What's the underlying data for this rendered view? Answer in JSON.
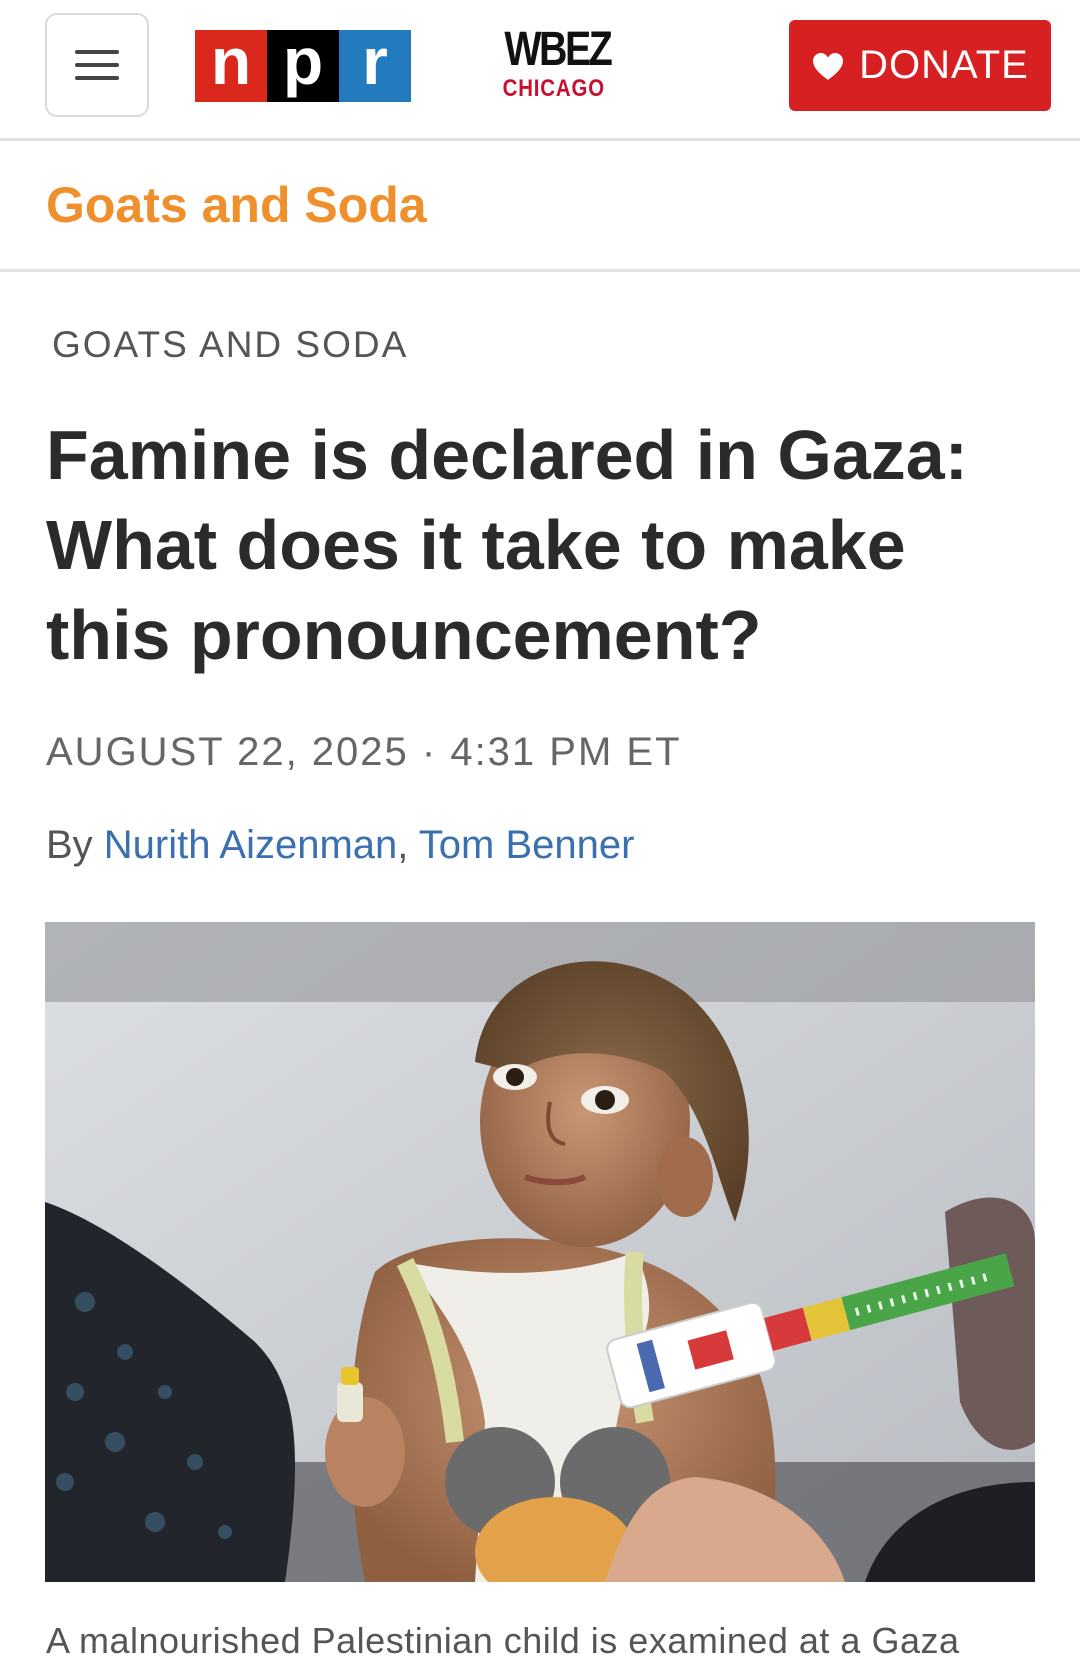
{
  "header": {
    "menu_icon": "hamburger-menu-icon",
    "npr_letters": [
      "n",
      "p",
      "r"
    ],
    "npr_colors": [
      "#da291c",
      "#000000",
      "#237bbd"
    ],
    "station_name": "WBEZ",
    "station_city": "CHICAGO",
    "donate_label": "DONATE",
    "donate_icon": "heart-icon",
    "donate_color": "#d62021"
  },
  "section": {
    "title": "Goats and Soda",
    "accent_color": "#f0902d"
  },
  "article": {
    "eyebrow": "GOATS AND SODA",
    "headline": "Famine is declared in Gaza: What does it take to make this pronouncement?",
    "dateline": "AUGUST 22, 2025 · 4:31 PM ET",
    "byline_prefix": "By ",
    "byline_separator": ", ",
    "authors": [
      "Nurith Aizenman",
      "Tom Benner"
    ],
    "author_link_color": "#3a6fb0",
    "photo_alt": "A malnourished Palestinian child having their arm measured with a MUAC tape",
    "caption": "A malnourished Palestinian child is examined at a Gaza"
  }
}
